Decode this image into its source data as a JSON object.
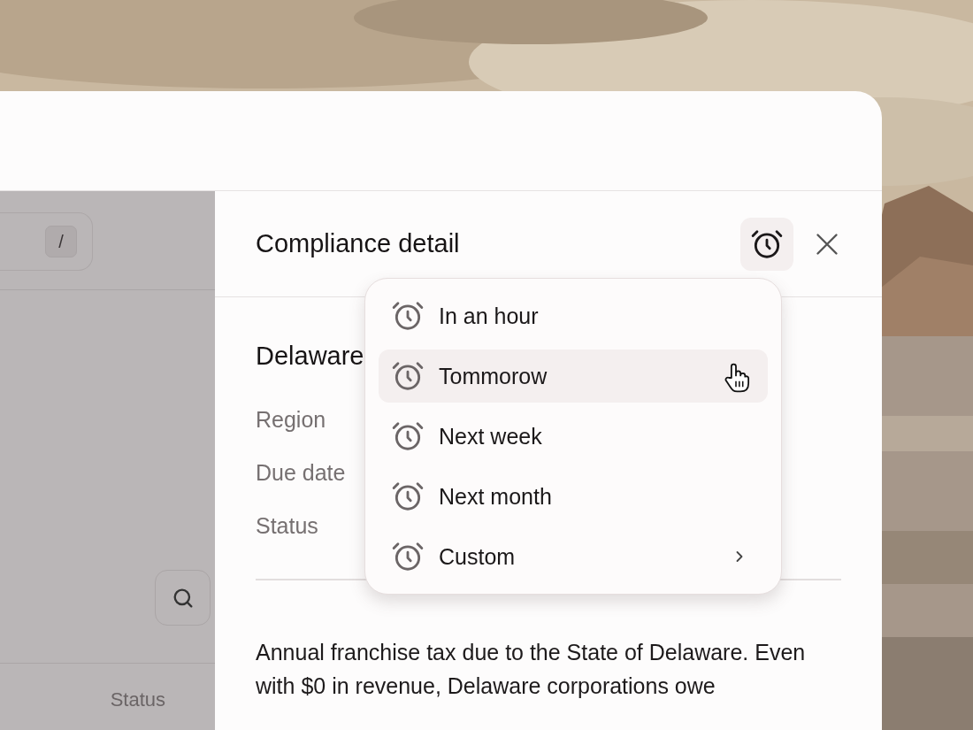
{
  "list_pane": {
    "search": {
      "shortcut": "/"
    },
    "column_header": "Status"
  },
  "detail": {
    "title": "Compliance detail",
    "remind_button": {
      "expanded": true
    },
    "heading": "Delaware",
    "fields": [
      {
        "label": "Region"
      },
      {
        "label": "Due date"
      },
      {
        "label": "Status"
      }
    ],
    "description": "Annual franchise tax due to the State of Delaware. Even with $0 in revenue, Delaware corporations owe"
  },
  "remind_menu": {
    "items": [
      {
        "label": "In an hour",
        "selected": false,
        "kind": "plain"
      },
      {
        "label": "Tommorow",
        "selected": true,
        "kind": "plain"
      },
      {
        "label": "Next week",
        "selected": false,
        "kind": "plain"
      },
      {
        "label": "Next month",
        "selected": false,
        "kind": "plain"
      },
      {
        "label": "Custom",
        "selected": false,
        "kind": "submenu"
      }
    ]
  }
}
